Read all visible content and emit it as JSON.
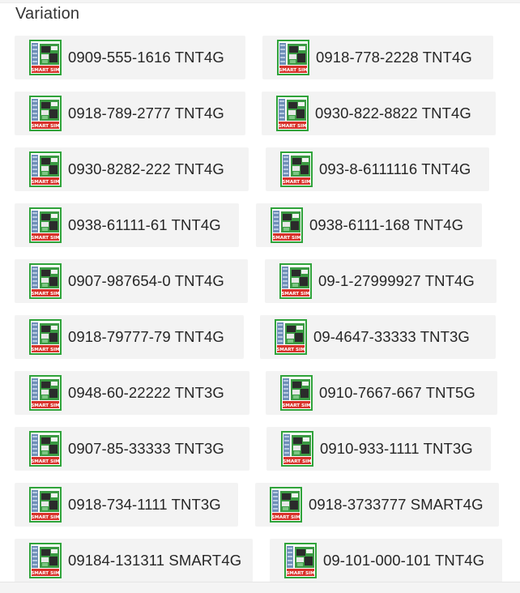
{
  "section": {
    "title": "Variation"
  },
  "options": [
    {
      "label": "0909-555-1616 TNT4G",
      "icon": "smart-sim-card-icon"
    },
    {
      "label": "0918-778-2228 TNT4G",
      "icon": "smart-sim-card-icon"
    },
    {
      "label": "0918-789-2777 TNT4G",
      "icon": "smart-sim-card-icon"
    },
    {
      "label": "0930-822-8822 TNT4G",
      "icon": "smart-sim-card-icon"
    },
    {
      "label": "0930-8282-222 TNT4G",
      "icon": "smart-sim-card-icon"
    },
    {
      "label": "093-8-6111116 TNT4G",
      "icon": "smart-sim-card-icon"
    },
    {
      "label": "0938-61111-61 TNT4G",
      "icon": "smart-sim-card-icon"
    },
    {
      "label": "0938-6111-168 TNT4G",
      "icon": "smart-sim-card-icon"
    },
    {
      "label": "0907-987654-0 TNT4G",
      "icon": "smart-sim-card-icon"
    },
    {
      "label": "09-1-27999927 TNT4G",
      "icon": "smart-sim-card-icon"
    },
    {
      "label": "0918-79777-79 TNT4G",
      "icon": "smart-sim-card-icon"
    },
    {
      "label": "09-4647-33333 TNT3G",
      "icon": "smart-sim-card-icon"
    },
    {
      "label": "0948-60-22222 TNT3G",
      "icon": "smart-sim-card-icon"
    },
    {
      "label": "0910-7667-667 TNT5G",
      "icon": "smart-sim-card-icon"
    },
    {
      "label": "0907-85-33333 TNT3G",
      "icon": "smart-sim-card-icon"
    },
    {
      "label": "0910-933-1111 TNT3G",
      "icon": "smart-sim-card-icon"
    },
    {
      "label": "0918-734-1111 TNT3G",
      "icon": "smart-sim-card-icon"
    },
    {
      "label": "0918-3733777 SMART4G",
      "icon": "smart-sim-card-icon"
    },
    {
      "label": "09184-131311 SMART4G",
      "icon": "smart-sim-card-icon"
    },
    {
      "label": "09-101-000-101 TNT4G",
      "icon": "smart-sim-card-icon"
    }
  ],
  "thumbnail": {
    "caption": "SMART SIM",
    "colors": {
      "border": "#2fa33a",
      "caption_bg": "#d8322b",
      "card_green": "#3b9a43",
      "dark": "#2b2b2b"
    }
  }
}
